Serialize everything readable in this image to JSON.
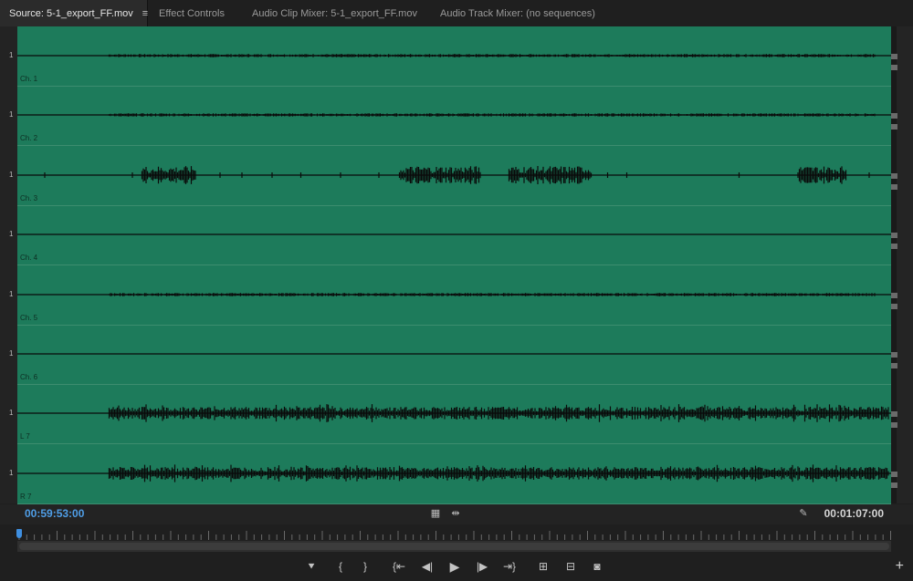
{
  "tabs": [
    {
      "label": "Source: 5-1_export_FF.mov",
      "active": true
    },
    {
      "label": "Effect Controls",
      "active": false
    },
    {
      "label": "Audio Clip Mixer: 5-1_export_FF.mov",
      "active": false
    },
    {
      "label": "Audio Track Mixer: (no sequences)",
      "active": false
    }
  ],
  "panel_menu_icon": "hamburger-menu-icon",
  "channels": [
    {
      "label": "Ch. 1",
      "scale": "1",
      "activity": "low"
    },
    {
      "label": "Ch. 2",
      "scale": "1",
      "activity": "low"
    },
    {
      "label": "Ch. 3",
      "scale": "1",
      "activity": "dialogue"
    },
    {
      "label": "Ch. 4",
      "scale": "1",
      "activity": "silent"
    },
    {
      "label": "Ch. 5",
      "scale": "1",
      "activity": "low"
    },
    {
      "label": "Ch. 6",
      "scale": "1",
      "activity": "silent"
    },
    {
      "label": "L 7",
      "scale": "1",
      "activity": "high"
    },
    {
      "label": "R 7",
      "scale": "1",
      "activity": "high"
    }
  ],
  "timecode_in": "00:59:53:00",
  "timecode_duration": "00:01:07:00",
  "colors": {
    "waveform_background": "#1d7b5b",
    "timecode_in": "#4f9ee7",
    "panel_background": "#1f1f1f"
  },
  "transport_buttons": [
    {
      "name": "add-marker-button",
      "glyph": "⯆"
    },
    {
      "name": "mark-in-button",
      "glyph": "{"
    },
    {
      "name": "mark-out-button",
      "glyph": "}"
    },
    {
      "name": "go-to-in-button",
      "glyph": "{⇤"
    },
    {
      "name": "step-back-button",
      "glyph": "◀|"
    },
    {
      "name": "play-button",
      "glyph": "▶"
    },
    {
      "name": "step-forward-button",
      "glyph": "|▶"
    },
    {
      "name": "go-to-out-button",
      "glyph": "⇥}"
    },
    {
      "name": "insert-button",
      "glyph": "⊞"
    },
    {
      "name": "overwrite-button",
      "glyph": "⊟"
    },
    {
      "name": "export-frame-button",
      "glyph": "◙"
    }
  ],
  "add_button": "+"
}
